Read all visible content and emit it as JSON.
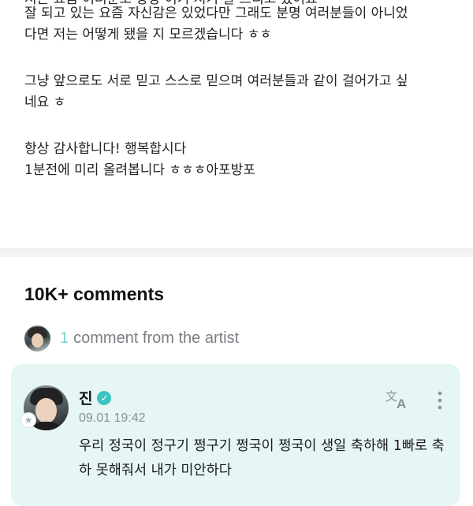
{
  "post": {
    "line_partial": "저는 요즘 여러분도 항상 여기 저기 잘 드리고 있어요",
    "line1": "잘 되고 있는 요즘 자신감은 있었다만 그래도 분명 여러분들이 아니었",
    "line2": "다면 저는 어떻게 됐을 지 모르겠습니다 ㅎㅎ",
    "line3": "그냥 앞으로도 서로 믿고 스스로 믿으며 여러분들과 같이 걸어가고 싶",
    "line4": "네요 ㅎ",
    "line5": "항상 감사합니다! 행복합시다",
    "line6": "1분전에 미리 올려봅니다 ㅎㅎㅎ아포방포"
  },
  "comments": {
    "title": "10K+ comments",
    "artist_count": "1",
    "artist_label": "comment from the artist"
  },
  "artist_comment": {
    "name": "진",
    "timestamp": "09.01 19:42",
    "text": "우리 정국이 정구기 쩡구기 쩡국이 쩡국이 생일 축하해 1빠로 축하 못해줘서 내가 미안하다",
    "icons": [
      "verified-badge-icon",
      "translate-icon",
      "more-vertical-icon",
      "star-icon"
    ]
  },
  "colors": {
    "accent": "#3dc3c0",
    "card_bg": "#e6f6f5",
    "muted": "#7d7d85"
  }
}
